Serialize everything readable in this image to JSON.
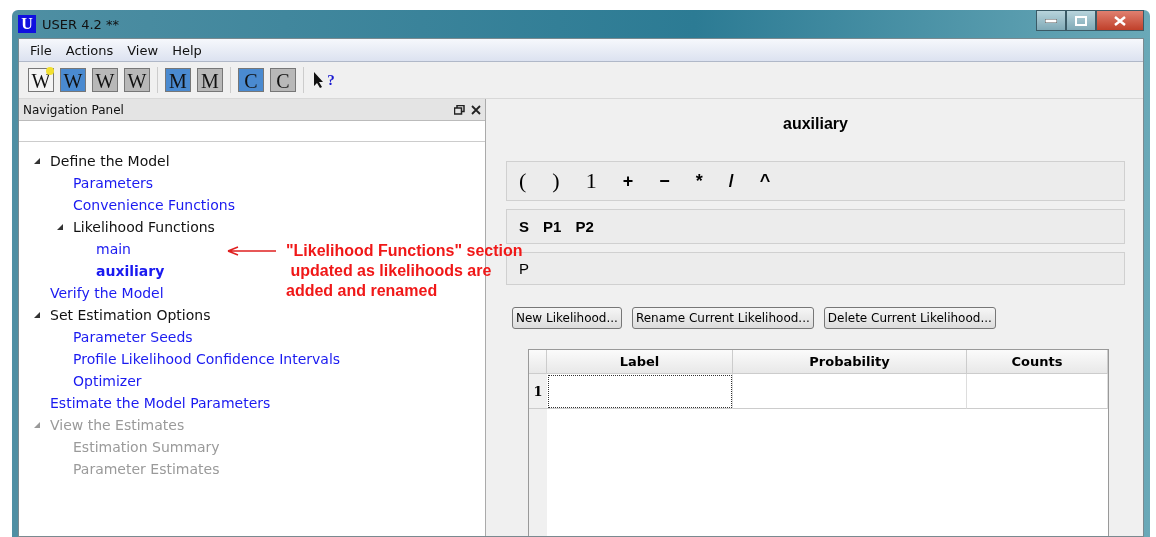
{
  "window": {
    "title": "USER 4.2 **",
    "app_letter": "U"
  },
  "menu": [
    "File",
    "Actions",
    "View",
    "Help"
  ],
  "toolbar": [
    {
      "letter": "W",
      "kind": "new"
    },
    {
      "letter": "W",
      "kind": "open"
    },
    {
      "letter": "W",
      "kind": "save"
    },
    {
      "letter": "W",
      "kind": "save"
    },
    {
      "letter": "M",
      "kind": "open"
    },
    {
      "letter": "M",
      "kind": "save"
    },
    {
      "letter": "C",
      "kind": "open"
    },
    {
      "letter": "C",
      "kind": "save"
    },
    {
      "letter": "?",
      "kind": "help"
    }
  ],
  "navigation_panel": {
    "title": "Navigation Panel",
    "tree": [
      {
        "label": "Define the Model",
        "kind": "group",
        "expanded": true,
        "disabled": false,
        "selected": false,
        "children": [
          {
            "label": "Parameters",
            "kind": "link",
            "disabled": false,
            "selected": false
          },
          {
            "label": "Convenience Functions",
            "kind": "link",
            "disabled": false,
            "selected": false
          },
          {
            "label": "Likelihood Functions",
            "kind": "group",
            "expanded": true,
            "disabled": false,
            "selected": false,
            "children": [
              {
                "label": "main",
                "kind": "link",
                "disabled": false,
                "selected": false
              },
              {
                "label": "auxiliary",
                "kind": "link",
                "disabled": false,
                "selected": true
              }
            ]
          }
        ]
      },
      {
        "label": "Verify the Model",
        "kind": "link",
        "disabled": false,
        "selected": false
      },
      {
        "label": "Set Estimation Options",
        "kind": "group",
        "expanded": true,
        "disabled": false,
        "selected": false,
        "children": [
          {
            "label": "Parameter Seeds",
            "kind": "link",
            "disabled": false,
            "selected": false
          },
          {
            "label": "Profile Likelihood Confidence Intervals",
            "kind": "link",
            "disabled": false,
            "selected": false
          },
          {
            "label": "Optimizer",
            "kind": "link",
            "disabled": false,
            "selected": false
          }
        ]
      },
      {
        "label": "Estimate the Model Parameters",
        "kind": "link",
        "disabled": false,
        "selected": false
      },
      {
        "label": "View the Estimates",
        "kind": "group",
        "expanded": true,
        "disabled": true,
        "selected": false,
        "children": [
          {
            "label": "Estimation Summary",
            "kind": "link",
            "disabled": true,
            "selected": false
          },
          {
            "label": "Parameter Estimates",
            "kind": "link",
            "disabled": true,
            "selected": false
          }
        ]
      }
    ]
  },
  "annotation": {
    "lines": [
      "\"Likelihood Functions\" section",
      " updated as likelihoods are",
      "added and renamed"
    ]
  },
  "editor": {
    "title": "auxiliary",
    "operators": [
      "(",
      ")",
      "1",
      "+",
      "−",
      "*",
      "/",
      "^"
    ],
    "variables": [
      "S",
      "P1",
      "P2"
    ],
    "expression": "P",
    "buttons": [
      "New Likelihood...",
      "Rename Current Likelihood...",
      "Delete Current Likelihood..."
    ],
    "table": {
      "columns": [
        "Label",
        "Probability",
        "Counts"
      ],
      "rows": [
        {
          "number": "1",
          "cells": [
            "",
            "",
            ""
          ]
        }
      ]
    }
  }
}
